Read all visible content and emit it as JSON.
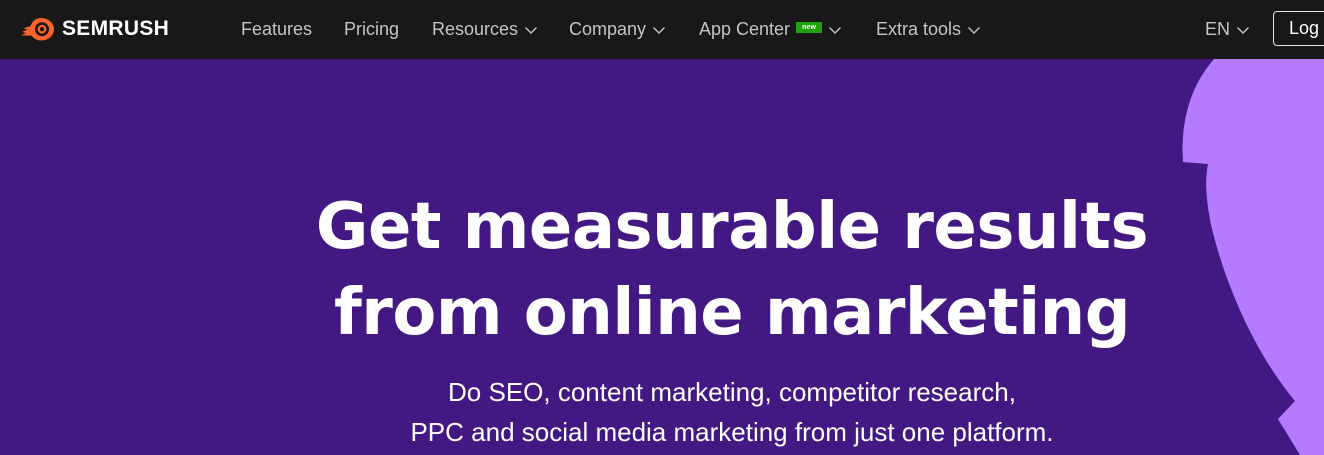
{
  "brand": {
    "name": "SEMRUSH",
    "accent": "#ff642d"
  },
  "nav": {
    "items": [
      {
        "label": "Features",
        "has_dropdown": false
      },
      {
        "label": "Pricing",
        "has_dropdown": false
      },
      {
        "label": "Resources",
        "has_dropdown": true
      },
      {
        "label": "Company",
        "has_dropdown": true
      },
      {
        "label": "App Center",
        "has_dropdown": true,
        "badge": "new"
      },
      {
        "label": "Extra tools",
        "has_dropdown": true
      }
    ],
    "language": "EN",
    "login_label": "Log"
  },
  "hero": {
    "title_lines": [
      "Get measurable results",
      "from online marketing"
    ],
    "subtitle_lines": [
      "Do SEO, content marketing, competitor research,",
      "PPC and social media marketing from just one platform."
    ]
  },
  "colors": {
    "topbar_bg": "#181818",
    "hero_bg": "#421983",
    "hero_shape": "#b57bff",
    "badge_bg": "#20a20c",
    "nav_text": "#c4c4c9"
  }
}
